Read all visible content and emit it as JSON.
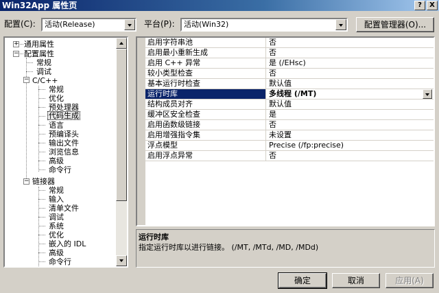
{
  "window": {
    "title": "Win32App 属性页",
    "help_btn": "?",
    "close_btn": "X"
  },
  "toolbar": {
    "config_label": "配置(C):",
    "config_value": "活动(Release)",
    "platform_label": "平台(P):",
    "platform_value": "活动(Win32)",
    "config_manager_btn": "配置管理器(O)..."
  },
  "tree": {
    "general": "通用属性",
    "config_props": "配置属性",
    "regular": "常规",
    "debug": "调试",
    "cpp": "C/C++",
    "cpp_items": [
      "常规",
      "优化",
      "预处理器",
      "代码生成",
      "语言",
      "预编译头",
      "输出文件",
      "浏览信息",
      "高级",
      "命令行"
    ],
    "linker": "链接器",
    "linker_items": [
      "常规",
      "输入",
      "清单文件",
      "调试",
      "系统",
      "优化",
      "嵌入的 IDL",
      "高级",
      "命令行"
    ]
  },
  "grid": {
    "rows": [
      {
        "k": "启用字符串池",
        "v": "否"
      },
      {
        "k": "启用最小重新生成",
        "v": "否"
      },
      {
        "k": "启用 C++ 异常",
        "v": "是 (/EHsc)"
      },
      {
        "k": "较小类型检查",
        "v": "否"
      },
      {
        "k": "基本运行时检查",
        "v": "默认值"
      },
      {
        "k": "运行时库",
        "v": "多线程 (/MT)"
      },
      {
        "k": "结构成员对齐",
        "v": "默认值"
      },
      {
        "k": "缓冲区安全检查",
        "v": "是"
      },
      {
        "k": "启用函数级链接",
        "v": "否"
      },
      {
        "k": "启用增强指令集",
        "v": "未设置"
      },
      {
        "k": "浮点模型",
        "v": "Precise (/fp:precise)"
      },
      {
        "k": "启用浮点异常",
        "v": "否"
      }
    ]
  },
  "description": {
    "title": "运行时库",
    "text": "指定运行时库以进行链接。    (/MT, /MTd, /MD, /MDd)"
  },
  "buttons": {
    "ok": "确定",
    "cancel": "取消",
    "apply": "应用(A)"
  }
}
